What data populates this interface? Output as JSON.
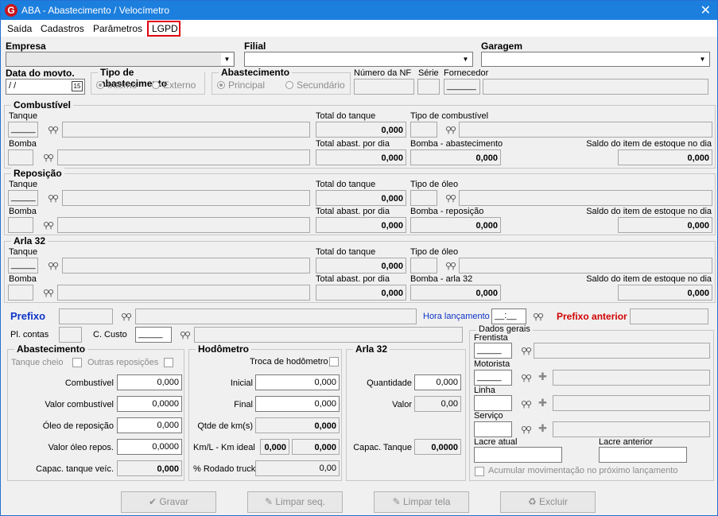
{
  "window": {
    "title": "ABA - Abastecimento / Velocímetro",
    "close": "✕",
    "logo": "G"
  },
  "menu": [
    "Saída",
    "Cadastros",
    "Parâmetros",
    "LGPD"
  ],
  "header": {
    "empresa": "Empresa",
    "filial": "Filial",
    "garagem": "Garagem",
    "data": "Data do movto.",
    "data_value": " /  /",
    "cal": "15",
    "tipo_title": "Tipo de abastecimento",
    "interno": "Interno",
    "externo": "Externo",
    "abast_title": "Abastecimento",
    "principal": "Principal",
    "secundario": "Secundário",
    "nf": "Número da NF",
    "serie": "Série",
    "fornecedor": "Fornecedor",
    "forn_mask": "______"
  },
  "sections": [
    {
      "title": "Combustível",
      "tanque": "Tanque",
      "total_tanque": "Total do tanque",
      "total_val": "0,000",
      "tipo": "Tipo de combustível",
      "bomba": "Bomba",
      "abast_dia": "Total abast. por dia",
      "abast_dia_val": "0,000",
      "bomba2": "Bomba - abastecimento",
      "bomba2_val": "0,000",
      "saldo": "Saldo do item de estoque no dia",
      "saldo_val": "0,000"
    },
    {
      "title": "Reposição",
      "tanque": "Tanque",
      "total_tanque": "Total do tanque",
      "total_val": "0,000",
      "tipo": "Tipo de óleo",
      "bomba": "Bomba",
      "abast_dia": "Total abast. por dia",
      "abast_dia_val": "0,000",
      "bomba2": "Bomba - reposição",
      "bomba2_val": "0,000",
      "saldo": "Saldo do item de estoque no dia",
      "saldo_val": "0,000"
    },
    {
      "title": "Arla 32",
      "tanque": "Tanque",
      "total_tanque": "Total do tanque",
      "total_val": "0,000",
      "tipo": "Tipo de óleo",
      "bomba": "Bomba",
      "abast_dia": "Total abast. por dia",
      "abast_dia_val": "0,000",
      "bomba2": "Bomba - arla 32",
      "bomba2_val": "0,000",
      "saldo": "Saldo do item de estoque no dia",
      "saldo_val": "0,000"
    }
  ],
  "mask": "_____",
  "prefixo": {
    "label": "Prefixo",
    "hora": "Hora lançamento",
    "hora_val": "__:__",
    "anterior": "Prefixo anterior",
    "pl_contas": "Pl. contas",
    "c_custo": "C. Custo",
    "cc_mask": "_____"
  },
  "abastecimento": {
    "title": "Abastecimento",
    "tanque_cheio": "Tanque cheio",
    "outras": "Outras reposições",
    "rows": [
      {
        "label": "Combustível",
        "value": "0,000"
      },
      {
        "label": "Valor combustível",
        "value": "0,0000"
      },
      {
        "label": "Óleo de reposição",
        "value": "0,000"
      },
      {
        "label": "Valor óleo repos.",
        "value": "0,0000"
      },
      {
        "label": "Capac. tanque veíc.",
        "value": "0,000"
      }
    ]
  },
  "hodometro": {
    "title": "Hodômetro",
    "troca": "Troca de hodômetro",
    "inicial": "Inicial",
    "inicial_val": "0,000",
    "final": "Final",
    "final_val": "0,000",
    "qtde": "Qtde de km(s)",
    "qtde_val": "0,000",
    "kml": "Km/L - Km ideal",
    "kml_val": "0,000",
    "kmideal_val": "0,000",
    "rodado": "% Rodado truck",
    "rodado_val": "0,00"
  },
  "arla": {
    "title": "Arla 32",
    "quantidade": "Quantidade",
    "quantidade_val": "0,000",
    "valor": "Valor",
    "valor_val": "0,00",
    "capac": "Capac. Tanque",
    "capac_val": "0,0000"
  },
  "dados": {
    "title": "Dados gerais",
    "frentista": "Frentista",
    "motorista": "Motorista",
    "linha": "Linha",
    "servico": "Serviço",
    "lacre_atual": "Lacre atual",
    "lacre_anterior": "Lacre anterior",
    "acumular": "Acumular movimentação no próximo lançamento"
  },
  "buttons": {
    "gravar": "Gravar",
    "limpar_seq": "Limpar seq.",
    "limpar_tela": "Limpar tela",
    "excluir": "Excluir"
  },
  "colors": {
    "title_bar": "#1c7fde",
    "prefixo": "#0d34c7",
    "hora": "#0d34c7",
    "prefixo_anterior": "#d00000",
    "lgpd_border": "#e3000f"
  }
}
